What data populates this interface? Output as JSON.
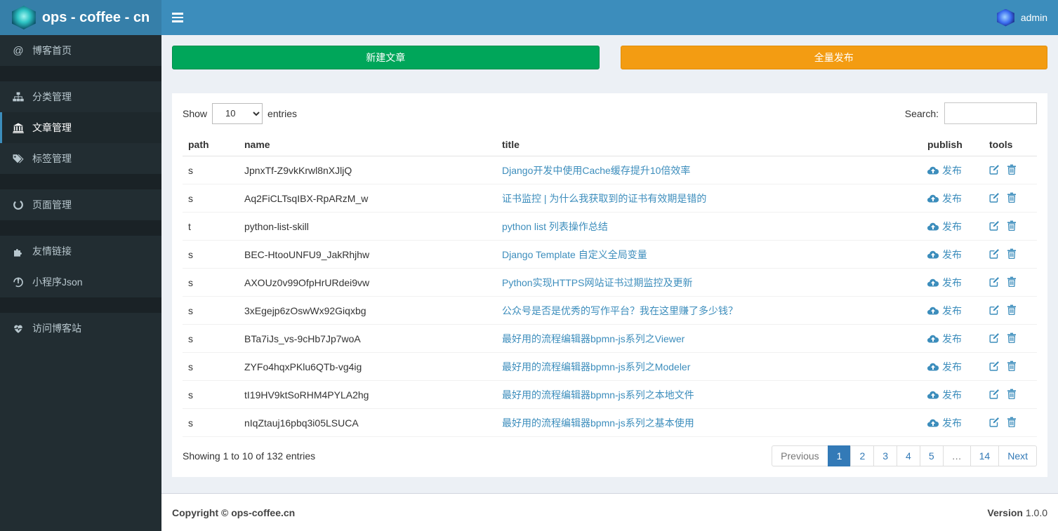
{
  "header": {
    "brand": "ops - coffee - cn",
    "user": "admin"
  },
  "sidebar": {
    "items": [
      {
        "label": "博客首页",
        "icon": "at-icon",
        "active": false
      },
      {
        "label": "分类管理",
        "icon": "sitemap-icon",
        "active": false
      },
      {
        "label": "文章管理",
        "icon": "bank-icon",
        "active": true
      },
      {
        "label": "标签管理",
        "icon": "tags-icon",
        "active": false
      },
      {
        "label": "页面管理",
        "icon": "circle-notch-icon",
        "active": false
      },
      {
        "label": "友情链接",
        "icon": "puzzle-icon",
        "active": false
      },
      {
        "label": "小程序Json",
        "icon": "rebel-icon",
        "active": false
      },
      {
        "label": "访问博客站",
        "icon": "heartbeat-icon",
        "active": false
      }
    ]
  },
  "actions": {
    "new_article": "新建文章",
    "publish_all": "全量发布"
  },
  "table": {
    "length_before": "Show",
    "length_value": "10",
    "length_after": "entries",
    "search_label": "Search:",
    "search_value": "",
    "columns": [
      "path",
      "name",
      "title",
      "publish",
      "tools"
    ],
    "publish_label": "发布",
    "rows": [
      {
        "path": "s",
        "name": "JpnxTf-Z9vkKrwl8nXJljQ",
        "title": "Django开发中使用Cache缓存提升10倍效率"
      },
      {
        "path": "s",
        "name": "Aq2FiCLTsqIBX-RpARzM_w",
        "title": "证书监控 | 为什么我获取到的证书有效期是错的"
      },
      {
        "path": "t",
        "name": "python-list-skill",
        "title": "python list 列表操作总结"
      },
      {
        "path": "s",
        "name": "BEC-HtooUNFU9_JakRhjhw",
        "title": "Django Template 自定义全局变量"
      },
      {
        "path": "s",
        "name": "AXOUz0v99OfpHrURdei9vw",
        "title": "Python实现HTTPS网站证书过期监控及更新"
      },
      {
        "path": "s",
        "name": "3xEgejp6zOswWx92Giqxbg",
        "title": "公众号是否是优秀的写作平台？我在这里赚了多少钱？"
      },
      {
        "path": "s",
        "name": "BTa7iJs_vs-9cHb7Jp7woA",
        "title": "最好用的流程编辑器bpmn-js系列之Viewer"
      },
      {
        "path": "s",
        "name": "ZYFo4hqxPKlu6QTb-vg4ig",
        "title": "最好用的流程编辑器bpmn-js系列之Modeler"
      },
      {
        "path": "s",
        "name": "tI19HV9ktSoRHM4PYLA2hg",
        "title": "最好用的流程编辑器bpmn-js系列之本地文件"
      },
      {
        "path": "s",
        "name": "nIqZtauj16pbq3i05LSUCA",
        "title": "最好用的流程编辑器bpmn-js系列之基本使用"
      }
    ],
    "info": "Showing 1 to 10 of 132 entries"
  },
  "pagination": {
    "previous": "Previous",
    "pages": [
      "1",
      "2",
      "3",
      "4",
      "5",
      "…",
      "14"
    ],
    "active": "1",
    "next": "Next"
  },
  "footer": {
    "copyright": "Copyright © ops-coffee.cn",
    "version_label": "Version",
    "version": "1.0.0"
  },
  "colors": {
    "navbar": "#3c8dbc",
    "logo_bg": "#367fa9",
    "sidebar_bg": "#222d32",
    "sidebar_active_bg": "#1e282c",
    "content_bg": "#ecf0f5",
    "button_new": "#00a65a",
    "button_publish_all": "#f39c12",
    "link": "#3c8dbc",
    "pagination_active": "#337ab7"
  }
}
